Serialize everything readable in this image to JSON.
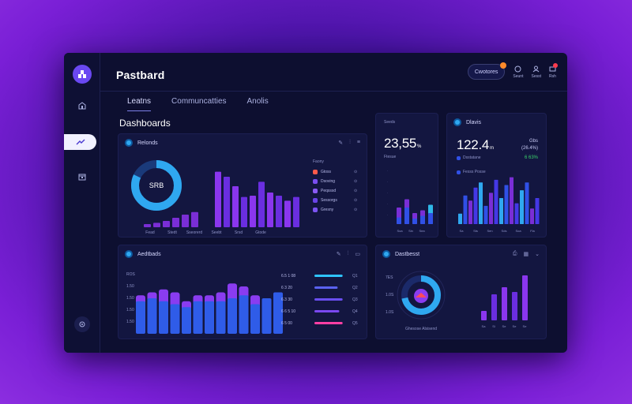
{
  "app": {
    "title": "Pastbard",
    "page_title": "Dashboards",
    "search_pill": "Cwotores",
    "header_buttons": [
      "Seunt",
      "Sesst",
      "Rsh"
    ]
  },
  "tabs": [
    {
      "label": "Leatns",
      "active": true
    },
    {
      "label": "Communcatties",
      "active": false
    },
    {
      "label": "Anolis",
      "active": false
    }
  ],
  "sidebar": {
    "items": [
      {
        "icon": "home-icon"
      },
      {
        "icon": "rocket-icon",
        "active": true
      },
      {
        "icon": "calendar-icon"
      },
      {
        "icon": "settings-icon"
      }
    ]
  },
  "card_reports": {
    "title": "Relonds",
    "donut_label": "SRB",
    "donut_fraction": 0.82,
    "legend_title": "Faony",
    "legend": [
      {
        "label": "Gtoss",
        "color": "#ff5a4a"
      },
      {
        "label": "Dsoving",
        "color": "#7a4ef0"
      },
      {
        "label": "Peqsssd",
        "color": "#8a5af5"
      },
      {
        "label": "Sessorgs",
        "color": "#6a44e8"
      },
      {
        "label": "Gresny",
        "color": "#7c54f2"
      }
    ],
    "x_labels": [
      "Fead",
      "Stedt",
      "Sseorerd",
      "Seebt",
      "Srsd",
      "Gtode"
    ],
    "left_bars": [
      0.05,
      0.07,
      0.1,
      0.15,
      0.2,
      0.24
    ],
    "main_bars": [
      0.88,
      0.8,
      0.65,
      0.48,
      0.5,
      0.72,
      0.55,
      0.5,
      0.42,
      0.48
    ]
  },
  "card_metric1": {
    "label": "Seeds",
    "value": "23,55",
    "unit": "%",
    "sub": "Ftesue",
    "x_labels": [
      "Soa",
      "Sin",
      "Sea"
    ],
    "bars": [
      [
        0.3,
        0.12
      ],
      [
        0.45,
        0.3
      ],
      [
        0.2,
        0.1
      ],
      [
        0.25,
        0.15
      ],
      [
        0.35,
        0.2
      ]
    ]
  },
  "card_metric2": {
    "title": "Dlavis",
    "value": "122.4",
    "unit": "m",
    "side_value": "(26.4%)",
    "side_label": "Gbs",
    "accent_value": "6 63%",
    "legend1": "Dsstatane",
    "legend2": "Fesss Posse",
    "x_labels": [
      "Sa",
      "Sts",
      "Sen",
      "Sds",
      "Soa",
      "Fla"
    ]
  },
  "card_analytics": {
    "title": "Aedtbads",
    "y_labels": [
      "ROS",
      "1.50",
      "1.50",
      "1.50",
      "1.50"
    ],
    "rows": [
      {
        "value": "6.5 1 08",
        "color": "#2fc4ff",
        "bar": 0.85,
        "end": "Q1"
      },
      {
        "value": "6 3 20",
        "color": "#5a62f0",
        "bar": 0.7,
        "end": "Q2"
      },
      {
        "value": "6.3 30",
        "color": "#6a4ef0",
        "bar": 0.85,
        "end": "Q3"
      },
      {
        "value": "6 6 5 10",
        "color": "#7a48f0",
        "bar": 0.75,
        "end": "Q4"
      },
      {
        "value": "6 5 00",
        "color": "#ff3fa5",
        "bar": 0.85,
        "end": "Q5"
      }
    ],
    "bars": [
      [
        0.55,
        0.1
      ],
      [
        0.6,
        0.1
      ],
      [
        0.55,
        0.2
      ],
      [
        0.5,
        0.2
      ],
      [
        0.45,
        0.1
      ],
      [
        0.55,
        0.1
      ],
      [
        0.55,
        0.1
      ],
      [
        0.55,
        0.15
      ],
      [
        0.6,
        0.25
      ],
      [
        0.65,
        0.15
      ],
      [
        0.5,
        0.15
      ],
      [
        0.6,
        0.0
      ],
      [
        0.7,
        0.0
      ]
    ]
  },
  "card_dashboard": {
    "title": "Dastbesst",
    "y_labels": [
      "7ES",
      "1.0S",
      "1.0S"
    ],
    "gauge_caption": "Ghesose Alsisend",
    "gauge_fraction": 0.72,
    "x_labels": [
      "Sa",
      "Si",
      "Se",
      "Se",
      "Se"
    ],
    "bars": [
      0.2,
      0.55,
      0.7,
      0.6,
      0.95
    ]
  },
  "colors": {
    "accent": "#6a48f2",
    "cyan": "#2fa8f0",
    "violet": "#8a3cf0",
    "blue": "#3050e6",
    "green": "#3ad16a"
  }
}
